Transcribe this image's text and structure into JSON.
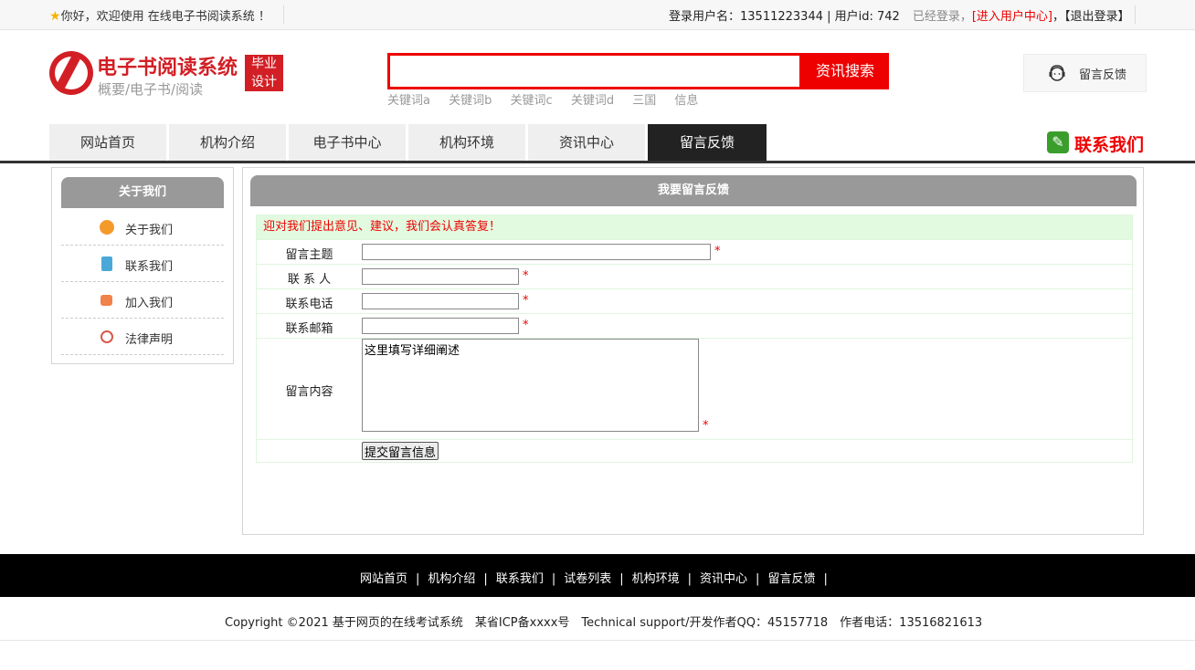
{
  "topbar": {
    "welcome": "你好，欢迎使用 在线电子书阅读系统 ！",
    "user_label": "登录用户名：13511223344 | 用户id: 742",
    "logged_status": "已经登录，",
    "user_center": "[进入用户中心]",
    "logout": "【退出登录】"
  },
  "header": {
    "logo_title": "电子书阅读系统",
    "logo_sub": "概要/电子书/阅读",
    "badge_line1": "毕业",
    "badge_line2": "设计",
    "search_value": "",
    "search_button": "资讯搜索",
    "keywords": [
      "关键词a",
      "关键词b",
      "关键词c",
      "关键词d",
      "三国",
      "信息"
    ],
    "feedback": "留言反馈"
  },
  "nav": {
    "items": [
      "网站首页",
      "机构介绍",
      "电子书中心",
      "机构环境",
      "资讯中心",
      "留言反馈"
    ],
    "active_index": 5,
    "contact": "联系我们"
  },
  "sidebar": {
    "title": "关于我们",
    "items": [
      {
        "label": "关于我们",
        "icon": "orange-circle-icon"
      },
      {
        "label": "联系我们",
        "icon": "clipboard-icon"
      },
      {
        "label": "加入我们",
        "icon": "lock-icon"
      },
      {
        "label": "法律声明",
        "icon": "power-icon"
      }
    ]
  },
  "main": {
    "title": "我要留言反馈",
    "notice": "迎对我们提出意见、建议，我们会认真答复！",
    "fields": {
      "subject_label": "留言主题",
      "contact_label": "联 系 人",
      "phone_label": "联系电话",
      "email_label": "联系邮箱",
      "content_label": "留言内容",
      "subject_value": "",
      "contact_value": "",
      "phone_value": "",
      "email_value": "",
      "content_value": "这里填写详细阐述",
      "required_mark": "*"
    },
    "submit": "提交留言信息"
  },
  "footer": {
    "links": [
      "网站首页",
      "机构介绍",
      "联系我们",
      "试卷列表",
      "机构环境",
      "资讯中心",
      "留言反馈"
    ],
    "separator": "|",
    "copyright": "Copyright ©2021 基于网页的在线考试系统",
    "icp": "某省ICP备xxxx号",
    "support": "Technical support/开发作者QQ：45157718",
    "phone": "作者电话：13516821613"
  },
  "colors": {
    "brand_red": "#d21f25",
    "accent_red": "#ee0000",
    "nav_active": "#222222",
    "panel_header": "#999999",
    "notice_bg": "#e2fbe0"
  }
}
